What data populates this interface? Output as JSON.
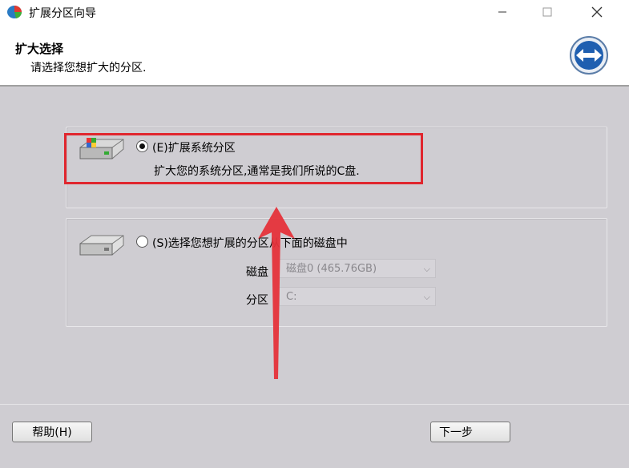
{
  "window": {
    "title": "扩展分区向导",
    "icon": "partition-app-icon",
    "controls": [
      "minimize-icon",
      "maximize-icon",
      "close-icon"
    ]
  },
  "header": {
    "title": "扩大选择",
    "subtitle": "请选择您想扩大的分区.",
    "logo": "resize-arrows-icon"
  },
  "options": {
    "system": {
      "label": "(E)扩展系统分区",
      "description": "扩大您的系统分区,通常是我们所说的C盘.",
      "checked": true
    },
    "custom": {
      "label": "(S)选择您想扩展的分区从下面的磁盘中",
      "checked": false,
      "disk_label": "磁盘",
      "disk_value": "磁盘0 (465.76GB)",
      "partition_label": "分区",
      "partition_value": "C:"
    }
  },
  "footer": {
    "help_label": "帮助(H)",
    "next_label": "下一步"
  },
  "colors": {
    "highlight": "#e0262e",
    "arrow": "#e5323a",
    "panel": "#cfcdd2"
  }
}
